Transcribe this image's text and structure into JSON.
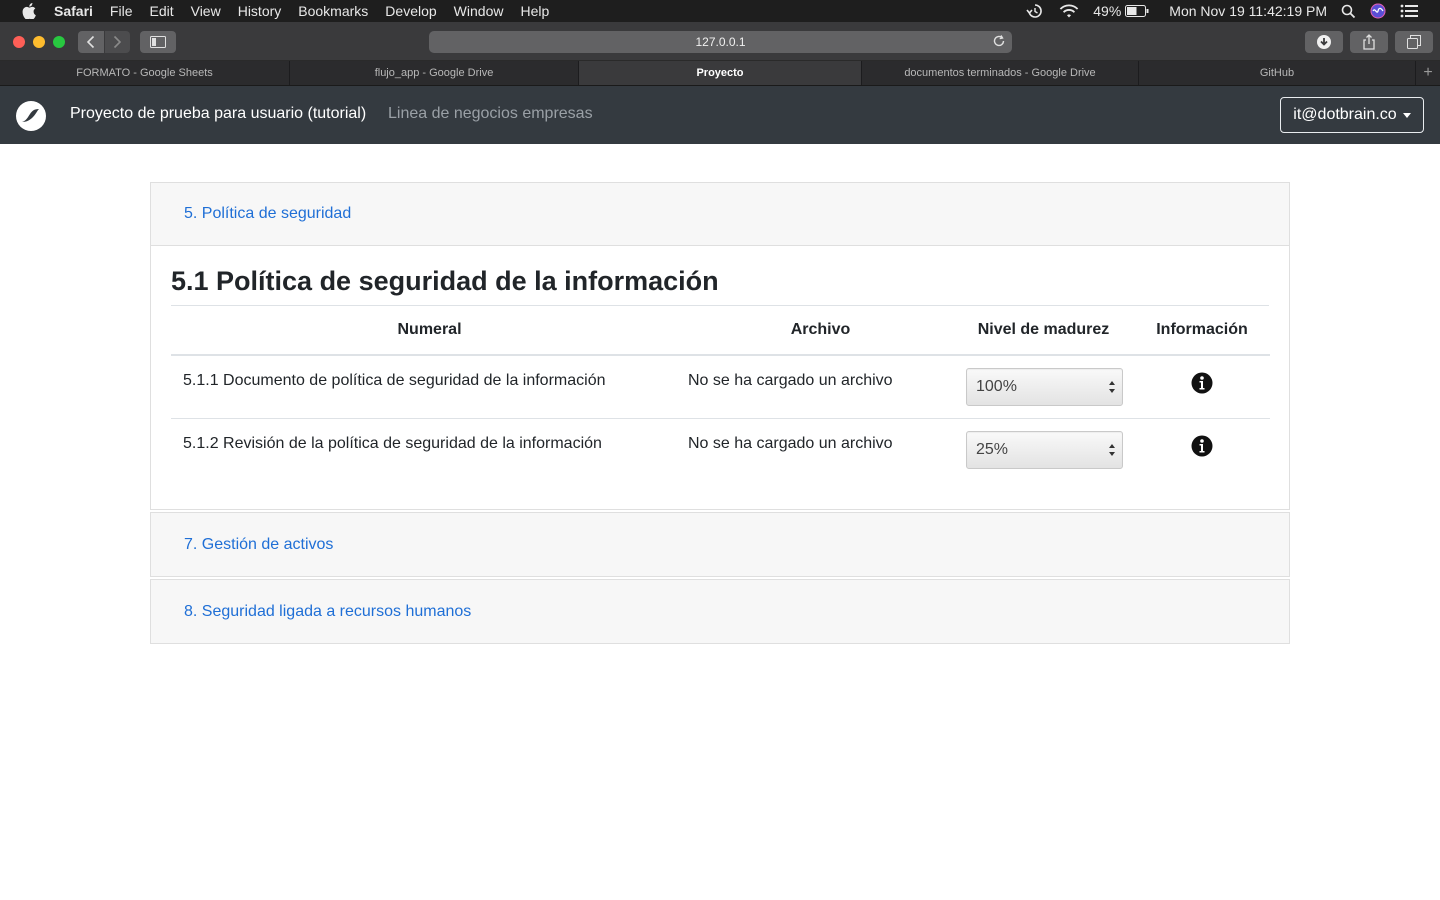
{
  "menubar": {
    "items": [
      "Safari",
      "File",
      "Edit",
      "View",
      "History",
      "Bookmarks",
      "Develop",
      "Window",
      "Help"
    ],
    "battery": "49%",
    "clock": "Mon Nov 19  11:42:19 PM"
  },
  "browser": {
    "url": "127.0.0.1",
    "tabs": [
      {
        "label": "FORMATO - Google Sheets"
      },
      {
        "label": "flujo_app - Google Drive"
      },
      {
        "label": "Proyecto"
      },
      {
        "label": "documentos terminados - Google Drive"
      },
      {
        "label": "GitHub"
      }
    ],
    "new_tab": "+"
  },
  "app": {
    "title": "Proyecto de prueba para usuario (tutorial)",
    "subtitle": "Linea de negocios empresas",
    "user": "it@dotbrain.co"
  },
  "sections": [
    {
      "header": "5. Política de seguridad",
      "title": "5.1 Política de seguridad de la información",
      "columns": [
        "Numeral",
        "Archivo",
        "Nivel de madurez",
        "Información"
      ],
      "rows": [
        {
          "numeral": "5.1.1 Documento de política de seguridad de la información",
          "archivo": "No se ha cargado un archivo",
          "nivel": "100%"
        },
        {
          "numeral": "5.1.2 Revisión de la política de seguridad de la información",
          "archivo": "No se ha cargado un archivo",
          "nivel": "25%"
        }
      ]
    },
    {
      "header": "7. Gestión de activos"
    },
    {
      "header": "8. Seguridad ligada a recursos humanos"
    }
  ],
  "icons": {
    "apple": "apple-icon",
    "time_machine": "time-machine-icon",
    "wifi": "wifi-icon",
    "battery": "battery-icon",
    "spotlight": "search-icon",
    "siri": "siri-icon",
    "notifications": "notification-center-icon",
    "info": "info-circle-icon"
  }
}
